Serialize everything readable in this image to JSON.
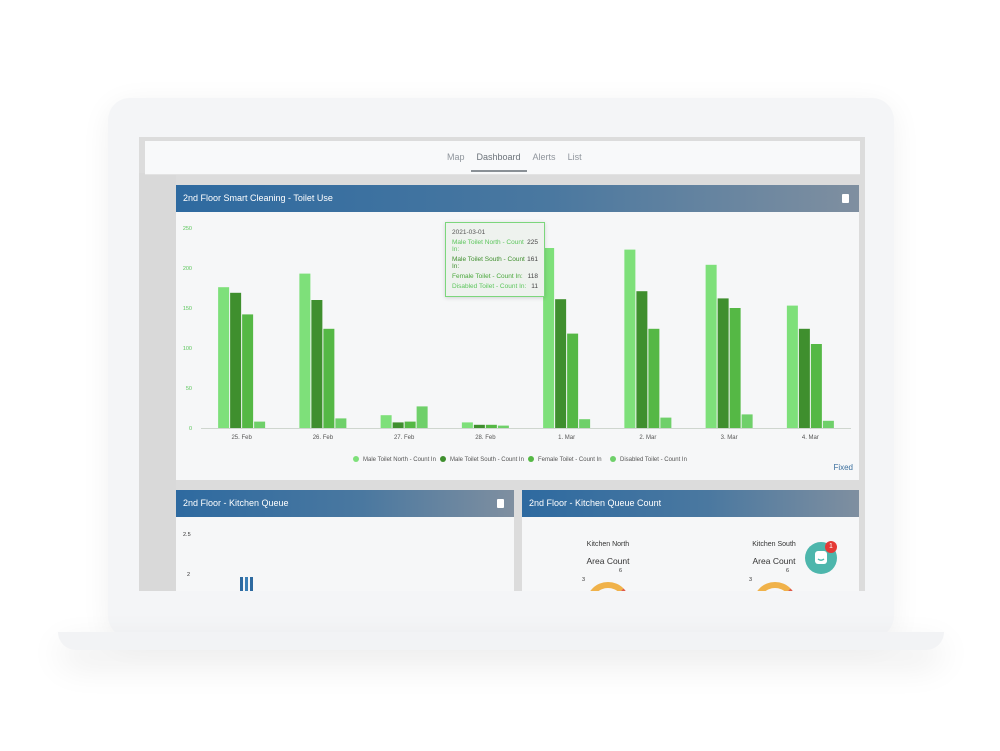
{
  "nav": {
    "tabs": [
      {
        "label": "Map",
        "active": false
      },
      {
        "label": "Dashboard",
        "active": true
      },
      {
        "label": "Alerts",
        "active": false
      },
      {
        "label": "List",
        "active": false
      }
    ]
  },
  "toilet_panel": {
    "title": "2nd Floor Smart Cleaning - Toilet Use",
    "fixed_label": "Fixed",
    "tooltip": {
      "date": "2021-03-01",
      "rows": [
        {
          "label": "Male Toilet North - Count In:",
          "value": "225"
        },
        {
          "label": "Male Toilet South - Count In:",
          "value": "161"
        },
        {
          "label": "Female Toilet - Count In:",
          "value": "118"
        },
        {
          "label": "Disabled Toilet - Count In:",
          "value": "11"
        }
      ]
    }
  },
  "kitchen_queue_panel": {
    "title": "2nd Floor - Kitchen Queue",
    "y_ticks": [
      "2.5",
      "2"
    ]
  },
  "kitchen_count_panel": {
    "title": "2nd Floor - Kitchen Queue Count",
    "north": {
      "label": "Kitchen North",
      "sub": "Area Count",
      "tick_left": "3",
      "tick_right": "6"
    },
    "south": {
      "label": "Kitchen South",
      "sub": "Area Count",
      "tick_left": "3",
      "tick_right": "6"
    }
  },
  "chat": {
    "badge": "1"
  },
  "colors": {
    "male_north": "#7ee07a",
    "male_south": "#3f8f2e",
    "female": "#55b845",
    "disabled": "#6fd06a",
    "header_blue": "#2e6aa0"
  },
  "chart_data": {
    "type": "bar",
    "categories": [
      "25. Feb",
      "26. Feb",
      "27. Feb",
      "28. Feb",
      "1. Mar",
      "2. Mar",
      "3. Mar",
      "4. Mar"
    ],
    "series": [
      {
        "name": "Male Toilet North - Count In",
        "color": "#7ee07a",
        "values": [
          176,
          193,
          16,
          7,
          225,
          223,
          204,
          153
        ]
      },
      {
        "name": "Male Toilet South - Count In",
        "color": "#3f8f2e",
        "values": [
          169,
          160,
          7,
          4,
          161,
          171,
          162,
          124
        ]
      },
      {
        "name": "Female Toilet - Count In",
        "color": "#55b845",
        "values": [
          142,
          124,
          8,
          4,
          118,
          124,
          150,
          105
        ]
      },
      {
        "name": "Disabled Toilet - Count In",
        "color": "#6fd06a",
        "values": [
          8,
          12,
          27,
          3,
          11,
          13,
          17,
          9
        ]
      }
    ],
    "y_ticks": [
      0,
      50,
      100,
      150,
      200,
      250
    ],
    "ylim": [
      0,
      250
    ],
    "grid": false,
    "legend": "bottom"
  }
}
